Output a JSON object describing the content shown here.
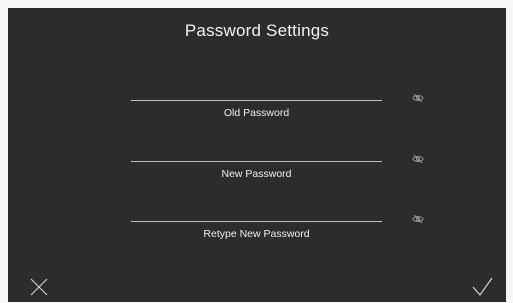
{
  "title": "Password Settings",
  "fields": [
    {
      "label": "Old Password",
      "value": ""
    },
    {
      "label": "New Password",
      "value": ""
    },
    {
      "label": "Retype New Password",
      "value": ""
    }
  ],
  "icons": {
    "visibility": "eye-off-icon",
    "cancel": "close-icon",
    "confirm": "checkmark-icon"
  },
  "colors": {
    "background": "#2c2c2d",
    "text": "#efefef",
    "underline": "#bdbdbd"
  }
}
